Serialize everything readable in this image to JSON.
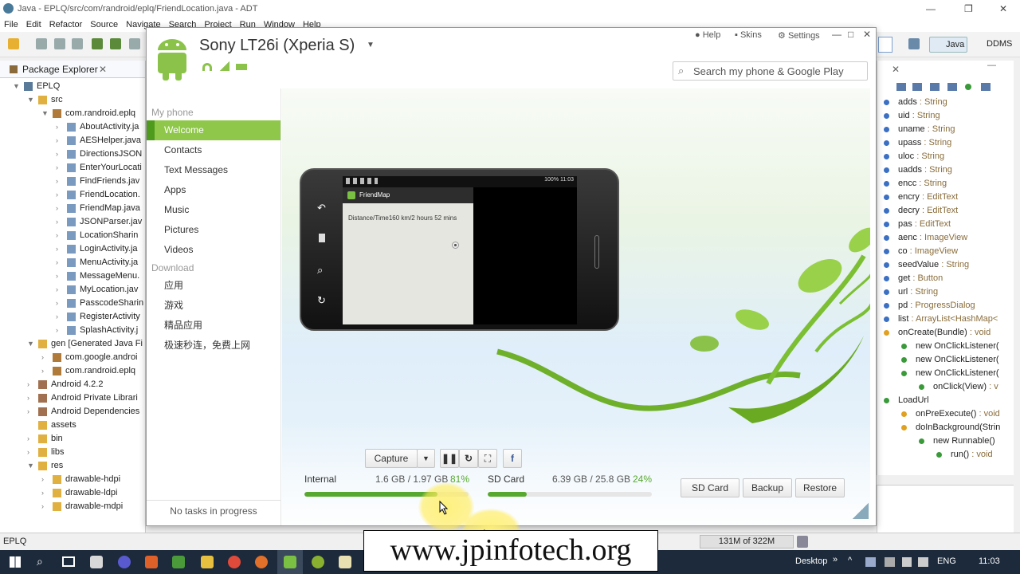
{
  "eclipse": {
    "title": "Java - EPLQ/src/com/randroid/eplq/FriendLocation.java - ADT",
    "menu": [
      "File",
      "Edit",
      "Refactor",
      "Source",
      "Navigate",
      "Search",
      "Project",
      "Run",
      "Window",
      "Help"
    ],
    "perspectives": [
      "Java",
      "DDMS"
    ],
    "package_explorer": {
      "title": "Package Explorer",
      "items": [
        {
          "label": "EPLQ",
          "indent": 0,
          "arrow": "▼",
          "icon": "project"
        },
        {
          "label": "src",
          "indent": 1,
          "arrow": "▼",
          "icon": "folder"
        },
        {
          "label": "com.randroid.eplq",
          "indent": 2,
          "arrow": "▼",
          "icon": "package"
        },
        {
          "label": "AboutActivity.ja",
          "indent": 3,
          "arrow": "›",
          "icon": "java"
        },
        {
          "label": "AESHelper.java",
          "indent": 3,
          "arrow": "›",
          "icon": "java"
        },
        {
          "label": "DirectionsJSON",
          "indent": 3,
          "arrow": "›",
          "icon": "java"
        },
        {
          "label": "EnterYourLocati",
          "indent": 3,
          "arrow": "›",
          "icon": "java"
        },
        {
          "label": "FindFriends.jav",
          "indent": 3,
          "arrow": "›",
          "icon": "java"
        },
        {
          "label": "FriendLocation.",
          "indent": 3,
          "arrow": "›",
          "icon": "java"
        },
        {
          "label": "FriendMap.java",
          "indent": 3,
          "arrow": "›",
          "icon": "java"
        },
        {
          "label": "JSONParser.jav",
          "indent": 3,
          "arrow": "›",
          "icon": "java"
        },
        {
          "label": "LocationSharin",
          "indent": 3,
          "arrow": "›",
          "icon": "java"
        },
        {
          "label": "LoginActivity.ja",
          "indent": 3,
          "arrow": "›",
          "icon": "java"
        },
        {
          "label": "MenuActivity.ja",
          "indent": 3,
          "arrow": "›",
          "icon": "java"
        },
        {
          "label": "MessageMenu.",
          "indent": 3,
          "arrow": "›",
          "icon": "java"
        },
        {
          "label": "MyLocation.jav",
          "indent": 3,
          "arrow": "›",
          "icon": "java"
        },
        {
          "label": "PasscodeSharin",
          "indent": 3,
          "arrow": "›",
          "icon": "java"
        },
        {
          "label": "RegisterActivity",
          "indent": 3,
          "arrow": "›",
          "icon": "java"
        },
        {
          "label": "SplashActivity.j",
          "indent": 3,
          "arrow": "›",
          "icon": "java"
        },
        {
          "label": "gen [Generated Java Fi",
          "indent": 1,
          "arrow": "▼",
          "icon": "folder"
        },
        {
          "label": "com.google.androi",
          "indent": 2,
          "arrow": "›",
          "icon": "package"
        },
        {
          "label": "com.randroid.eplq",
          "indent": 2,
          "arrow": "›",
          "icon": "package"
        },
        {
          "label": "Android 4.2.2",
          "indent": 1,
          "arrow": "›",
          "icon": "lib"
        },
        {
          "label": "Android Private Librari",
          "indent": 1,
          "arrow": "›",
          "icon": "lib"
        },
        {
          "label": "Android Dependencies",
          "indent": 1,
          "arrow": "›",
          "icon": "lib"
        },
        {
          "label": "assets",
          "indent": 1,
          "arrow": "",
          "icon": "folder"
        },
        {
          "label": "bin",
          "indent": 1,
          "arrow": "›",
          "icon": "folder"
        },
        {
          "label": "libs",
          "indent": 1,
          "arrow": "›",
          "icon": "folder"
        },
        {
          "label": "res",
          "indent": 1,
          "arrow": "▼",
          "icon": "folder"
        },
        {
          "label": "drawable-hdpi",
          "indent": 2,
          "arrow": "›",
          "icon": "folder"
        },
        {
          "label": "drawable-ldpi",
          "indent": 2,
          "arrow": "›",
          "icon": "folder"
        },
        {
          "label": "drawable-mdpi",
          "indent": 2,
          "arrow": "›",
          "icon": "folder"
        }
      ]
    },
    "outline": [
      {
        "name": "adds",
        "type": " : String",
        "indent": 0,
        "color": "#3a6fc4"
      },
      {
        "name": "uid",
        "type": " : String",
        "indent": 0,
        "color": "#3a6fc4"
      },
      {
        "name": "uname",
        "type": " : String",
        "indent": 0,
        "color": "#3a6fc4"
      },
      {
        "name": "upass",
        "type": " : String",
        "indent": 0,
        "color": "#3a6fc4"
      },
      {
        "name": "uloc",
        "type": " : String",
        "indent": 0,
        "color": "#3a6fc4"
      },
      {
        "name": "uadds",
        "type": " : String",
        "indent": 0,
        "color": "#3a6fc4"
      },
      {
        "name": "encc",
        "type": " : String",
        "indent": 0,
        "color": "#3a6fc4"
      },
      {
        "name": "encry",
        "type": " : EditText",
        "indent": 0,
        "color": "#3a6fc4"
      },
      {
        "name": "decry",
        "type": " : EditText",
        "indent": 0,
        "color": "#3a6fc4"
      },
      {
        "name": "pas",
        "type": " : EditText",
        "indent": 0,
        "color": "#3a6fc4"
      },
      {
        "name": "aenc",
        "type": " : ImageView",
        "indent": 0,
        "color": "#3a6fc4"
      },
      {
        "name": "co",
        "type": " : ImageView",
        "indent": 0,
        "color": "#3a6fc4"
      },
      {
        "name": "seedValue",
        "type": " : String",
        "indent": 0,
        "color": "#3a6fc4"
      },
      {
        "name": "get",
        "type": " : Button",
        "indent": 0,
        "color": "#3a6fc4"
      },
      {
        "name": "url",
        "type": " : String",
        "indent": 0,
        "color": "#3a6fc4"
      },
      {
        "name": "pd",
        "type": " : ProgressDialog",
        "indent": 0,
        "color": "#3a6fc4"
      },
      {
        "name": "list",
        "type": " : ArrayList<HashMap<",
        "indent": 0,
        "color": "#3a6fc4"
      },
      {
        "name": "onCreate(Bundle)",
        "type": " : void",
        "indent": 0,
        "color": "#e0a020"
      },
      {
        "name": "new OnClickListener(",
        "type": "",
        "indent": 1,
        "color": "#3a9a3a"
      },
      {
        "name": "new OnClickListener(",
        "type": "",
        "indent": 1,
        "color": "#3a9a3a"
      },
      {
        "name": "new OnClickListener(",
        "type": "",
        "indent": 1,
        "color": "#3a9a3a"
      },
      {
        "name": "onClick(View)",
        "type": " : v",
        "indent": 2,
        "color": "#3a9a3a"
      },
      {
        "name": "LoadUrl",
        "type": "",
        "indent": 0,
        "color": "#3a9a3a"
      },
      {
        "name": "onPreExecute()",
        "type": " : void",
        "indent": 1,
        "color": "#e0a020"
      },
      {
        "name": "doInBackground(Strin",
        "type": "",
        "indent": 1,
        "color": "#e0a020"
      },
      {
        "name": "new Runnable()",
        "type": "",
        "indent": 2,
        "color": "#3a9a3a"
      },
      {
        "name": "run()",
        "type": " : void",
        "indent": 3,
        "color": "#3a9a3a"
      }
    ],
    "status": {
      "project": "EPLQ",
      "heap": "131M of 322M"
    },
    "taskbar": {
      "desktop": "Desktop",
      "lang": "ENG",
      "time": "11:03"
    }
  },
  "phone_manager": {
    "device_name": "Sony LT26i (Xperia S)",
    "header_links": {
      "help": "Help",
      "skins": "Skins",
      "settings": "Settings"
    },
    "search_placeholder": "Search my phone & Google Play",
    "sidebar": {
      "my_phone": "My phone",
      "items": [
        "Welcome",
        "Contacts",
        "Text Messages",
        "Apps",
        "Music",
        "Pictures",
        "Videos"
      ],
      "download": "Download",
      "download_items": [
        "应用",
        "游戏",
        "精品应用",
        "极速秒连，免费上网"
      ],
      "tasks": "No tasks in progress"
    },
    "phone_screen": {
      "status_right": "100% 11:03",
      "app_title": "FriendMap",
      "content": "Distance/Time160 km/2 hours 52 mins"
    },
    "controls": {
      "capture": "Capture"
    },
    "storage": {
      "internal": {
        "label": "Internal",
        "used": "1.6 GB / 1.97 GB",
        "pct": "81%",
        "fill": 0.81
      },
      "sdcard": {
        "label": "SD Card",
        "used": "6.39 GB / 25.8 GB",
        "pct": "24%",
        "fill": 0.24
      }
    },
    "buttons": {
      "sdcard": "SD Card",
      "backup": "Backup",
      "restore": "Restore"
    }
  },
  "watermark": "www.jpinfotech.org",
  "colors": {
    "accent_green": "#8fc74a",
    "progress_green": "#56a82e"
  }
}
